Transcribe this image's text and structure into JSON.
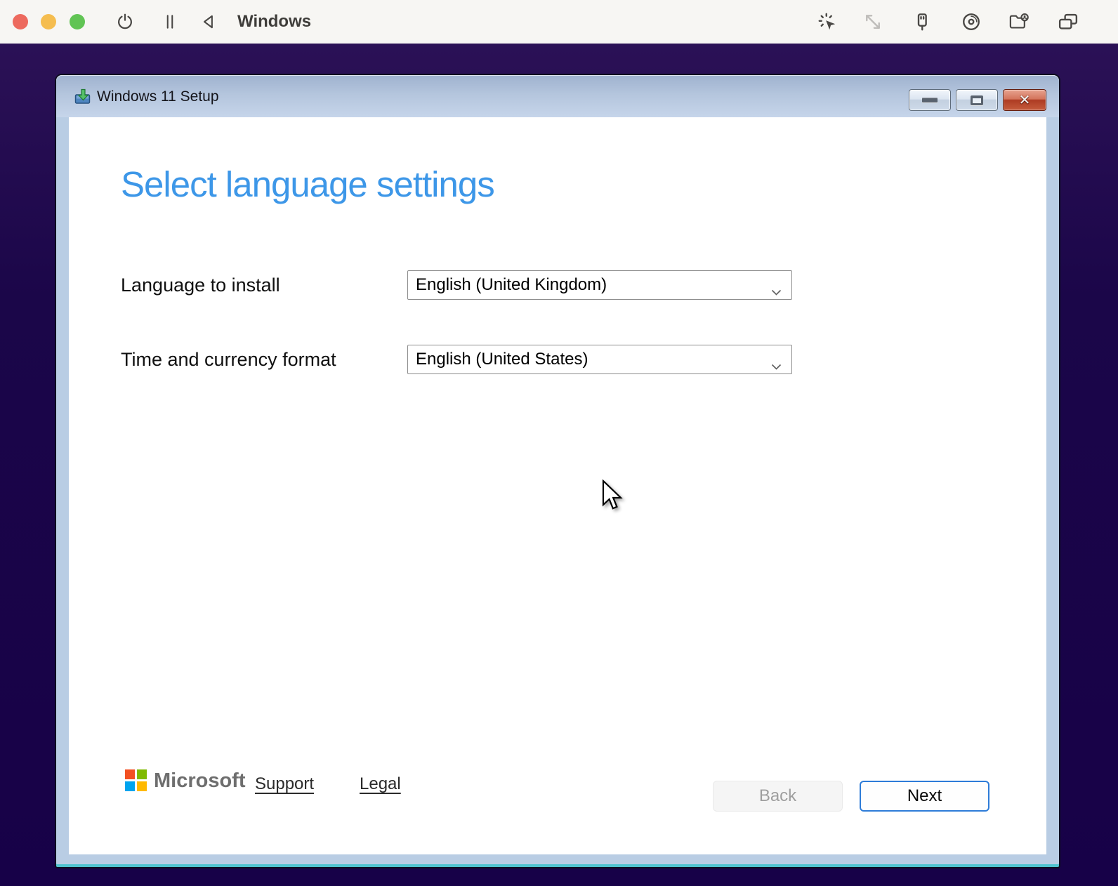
{
  "vm_toolbar": {
    "window_title": "Windows",
    "traffic_lights": [
      "close",
      "minimize",
      "zoom"
    ],
    "left_icons": [
      "power-icon",
      "pause-icon",
      "back-triangle-icon"
    ],
    "right_icons": [
      "capture-cursor-icon",
      "resize-display-icon",
      "usb-icon",
      "cd-drive-icon",
      "shared-folder-icon",
      "window-list-icon"
    ]
  },
  "setup_window": {
    "title": "Windows 11 Setup",
    "title_icon": "installer-icon",
    "window_buttons": [
      "minimize",
      "maximize",
      "close"
    ],
    "heading": "Select language settings",
    "fields": [
      {
        "label": "Language to install",
        "value": "English (United Kingdom)"
      },
      {
        "label": "Time and currency format",
        "value": "English (United States)"
      }
    ],
    "footer": {
      "brand": "Microsoft",
      "links": [
        {
          "label": "Support"
        },
        {
          "label": "Legal"
        }
      ],
      "back_label": "Back",
      "next_label": "Next"
    }
  },
  "colors": {
    "desktop_background_top": "#2B1156",
    "desktop_background_bottom": "#170148",
    "titlebar_gradient_top": "#9FB2CF",
    "titlebar_gradient_bottom": "#C6D5EA",
    "window_frame": "#B9CDE4",
    "frame_accent_teal": "#4FC3CF",
    "heading_blue": "#3D97E8",
    "next_button_border": "#2E7CD8",
    "close_button_red": "#AE3C23",
    "traffic_red": "#ED6A5E",
    "traffic_yellow": "#F5BD4F",
    "traffic_green": "#61C454",
    "ms_logo_red": "#F25022",
    "ms_logo_green": "#7FBA00",
    "ms_logo_blue": "#00A4EF",
    "ms_logo_yellow": "#FFB900"
  }
}
